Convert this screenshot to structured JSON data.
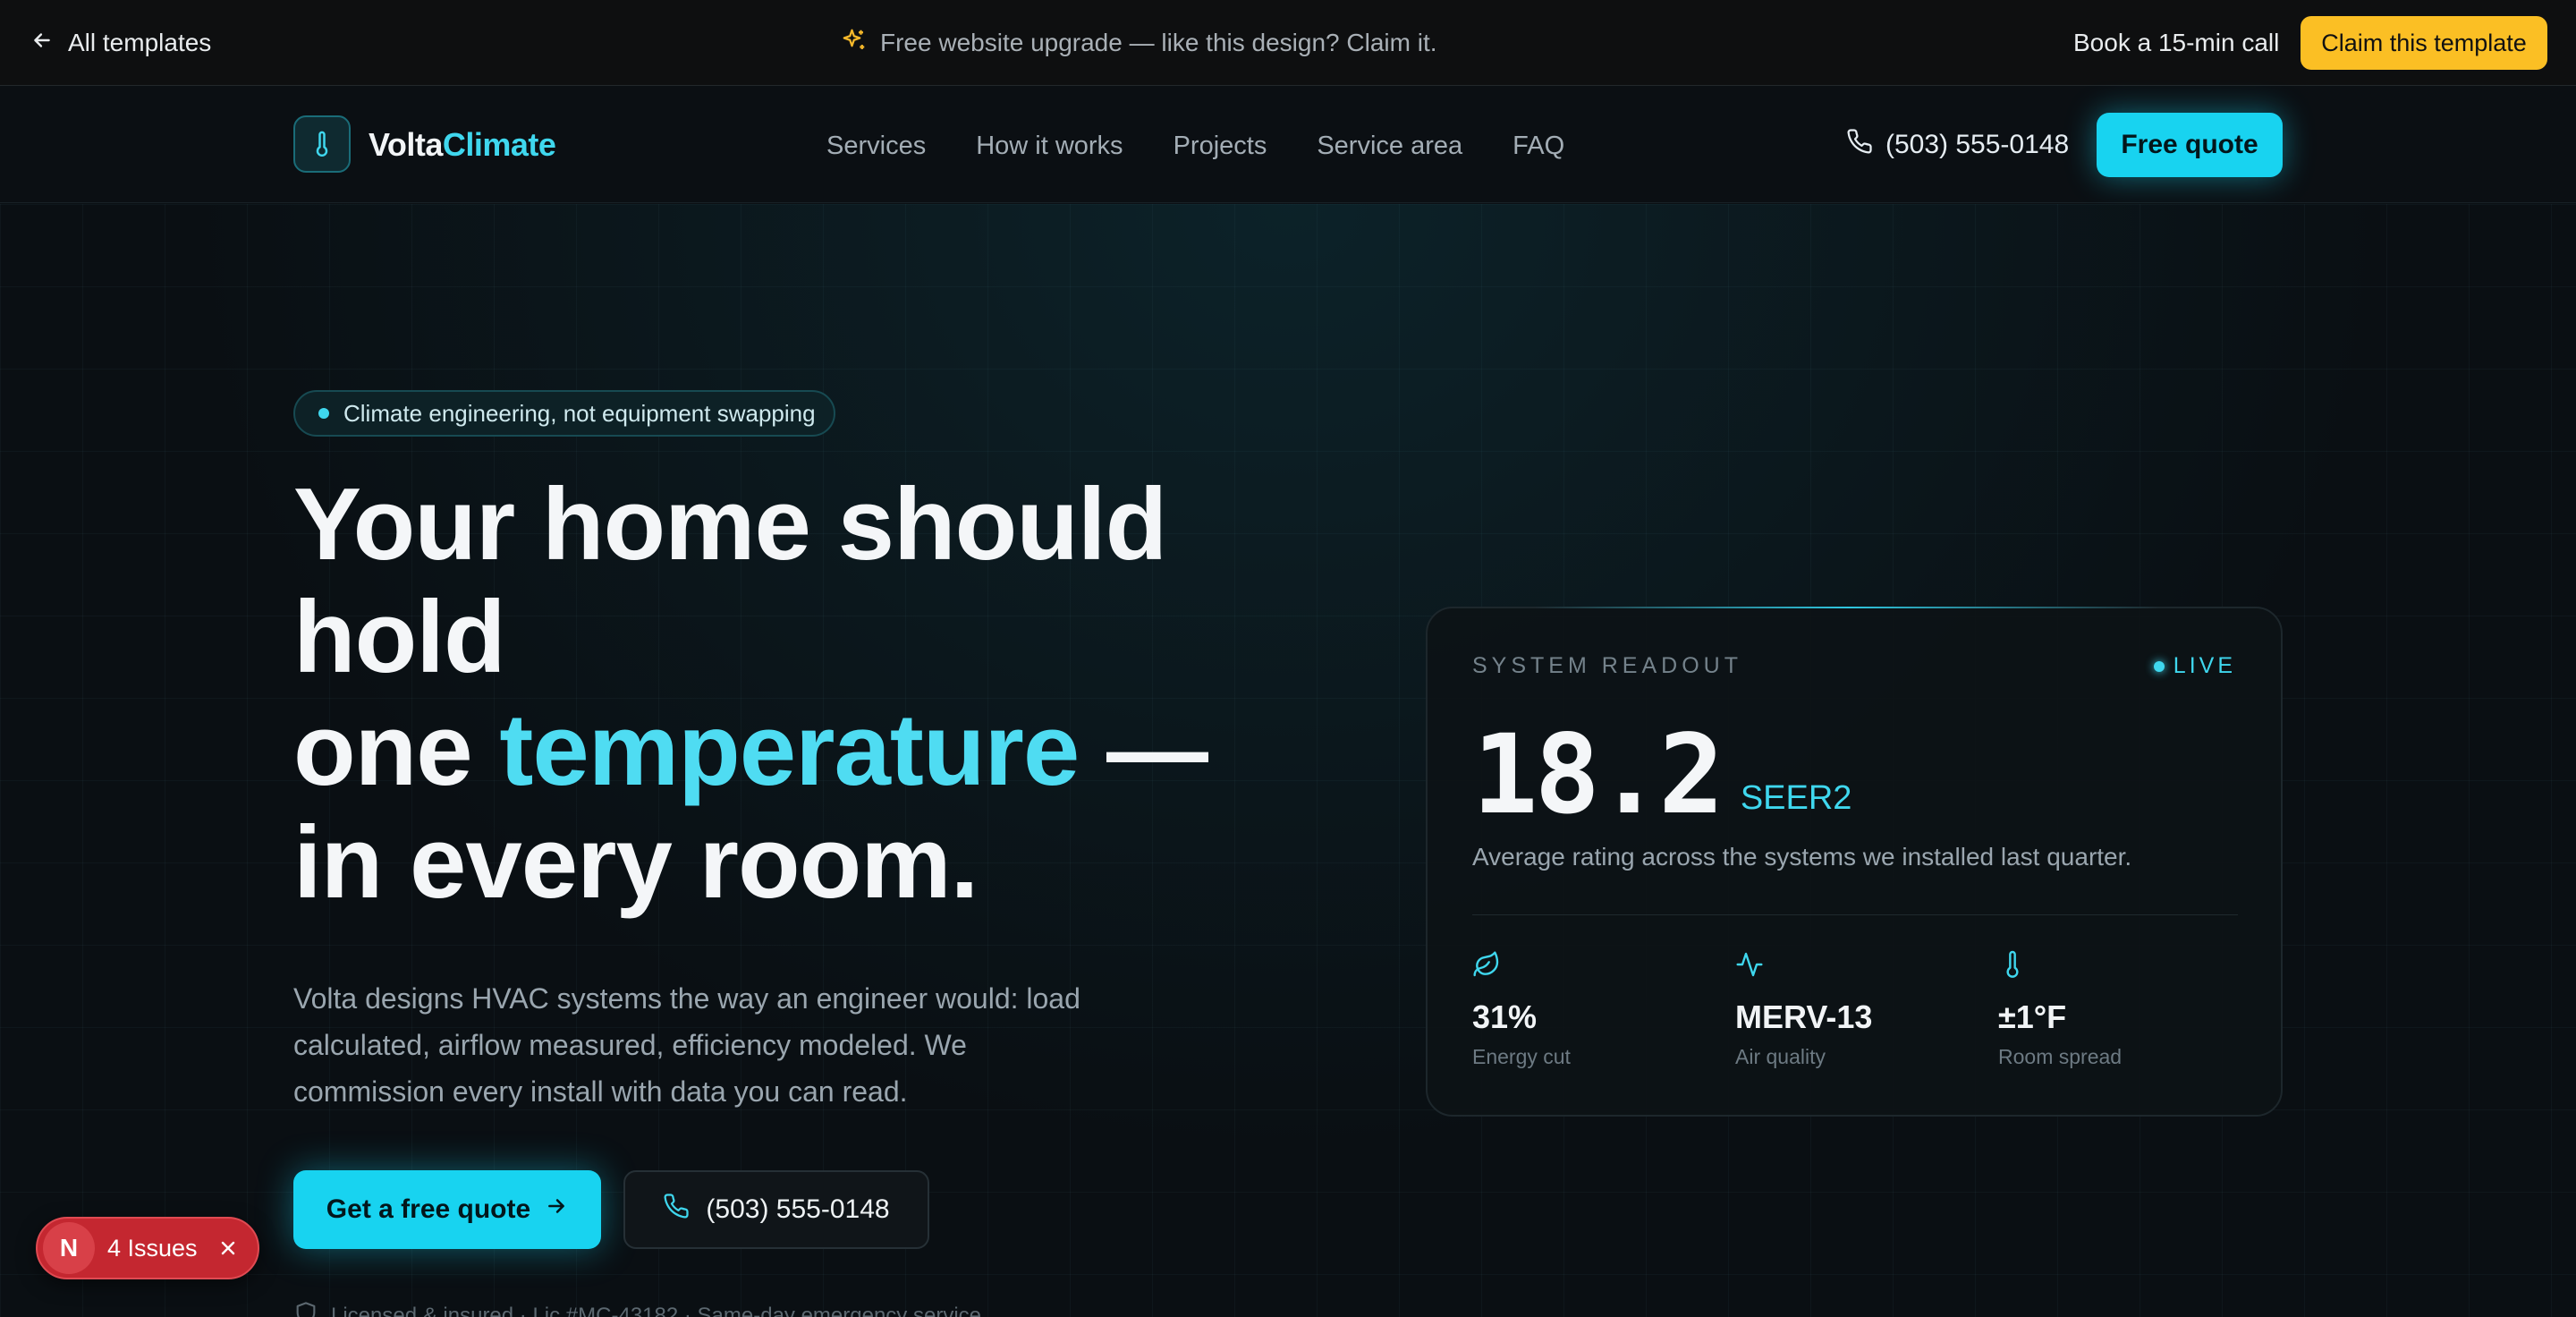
{
  "promo": {
    "back_label": "All templates",
    "message": "Free website upgrade — like this design? Claim it.",
    "book_call": "Book a 15-min call",
    "claim": "Claim this template"
  },
  "nav": {
    "brand_part1": "Volta",
    "brand_part2": "Climate",
    "menu": [
      "Services",
      "How it works",
      "Projects",
      "Service area",
      "FAQ"
    ],
    "phone": "(503) 555-0148",
    "quote": "Free quote"
  },
  "hero": {
    "pill": "Climate engineering, not equipment swapping",
    "headline_line1": "Your home should",
    "headline_line2": "hold",
    "headline_line3_pre": "one ",
    "headline_accent": "temperature",
    "headline_line3_post": " —",
    "headline_line4": "in every room.",
    "subtext": "Volta designs HVAC systems the way an engineer would: load calculated, airflow measured, efficiency modeled. We commission every install with data you can read.",
    "cta_primary": "Get a free quote",
    "cta_secondary": "(503) 555-0148",
    "license_text": "Licensed & insured · Lic #MC-43182 · Same-day emergency service"
  },
  "readout": {
    "label": "SYSTEM READOUT",
    "live": "LIVE",
    "value": "18.2",
    "unit": "SEER2",
    "description": "Average rating across the systems we installed last quarter.",
    "stats": [
      {
        "icon": "leaf-icon",
        "value": "31%",
        "label": "Energy cut"
      },
      {
        "icon": "activity-icon",
        "value": "MERV-13",
        "label": "Air quality"
      },
      {
        "icon": "thermometer-icon",
        "value": "±1°F",
        "label": "Room spread"
      }
    ]
  },
  "issues": {
    "badge": "N",
    "text": "4 Issues"
  },
  "colors": {
    "accent": "#18d3f0",
    "accent_text": "#4fdcf2",
    "claim": "#fbbf24",
    "issues": "#c42730",
    "background": "#0a0f13"
  }
}
